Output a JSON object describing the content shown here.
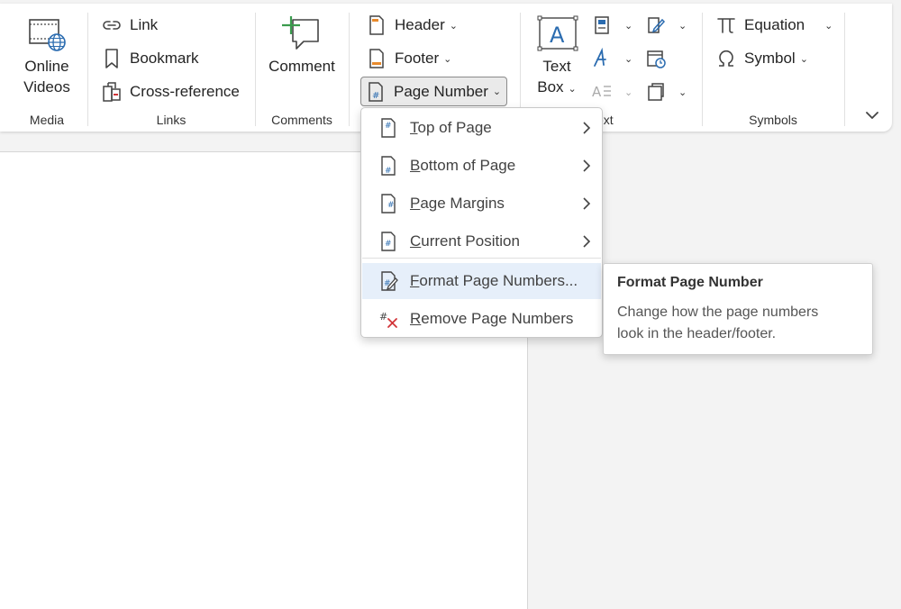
{
  "ribbon": {
    "media": {
      "label": "Media",
      "online_videos_line1": "Online",
      "online_videos_line2": "Videos"
    },
    "links": {
      "label": "Links",
      "link": "Link",
      "bookmark": "Bookmark",
      "cross_reference": "Cross-reference"
    },
    "comments": {
      "label": "Comments",
      "comment": "Comment"
    },
    "header_footer": {
      "header": "Header",
      "footer": "Footer",
      "page_number": "Page Number"
    },
    "text": {
      "label_visible": "ext",
      "text_box_line1": "Text",
      "text_box_line2": "Box"
    },
    "symbols": {
      "label": "Symbols",
      "equation": "Equation",
      "symbol": "Symbol"
    },
    "chevron": "⌄"
  },
  "page_number_menu": {
    "items": [
      {
        "label": "Top of Page",
        "accel": "T",
        "rest": "op of Page",
        "submenu": true
      },
      {
        "label": "Bottom of Page",
        "accel": "B",
        "rest": "ottom of Page",
        "submenu": true
      },
      {
        "label": "Page Margins",
        "accel": "P",
        "rest": "age Margins",
        "submenu": true
      },
      {
        "label": "Current Position",
        "accel": "C",
        "rest": "urrent Position",
        "submenu": true
      },
      {
        "label": "Format Page Numbers...",
        "accel": "F",
        "rest": "ormat Page Numbers...",
        "submenu": false,
        "highlighted": true
      },
      {
        "label": "Remove Page Numbers",
        "accel": "R",
        "rest": "emove Page Numbers",
        "submenu": false
      }
    ]
  },
  "tooltip": {
    "title": "Format Page Number",
    "body_line1": "Change how the page numbers",
    "body_line2": "look in the header/footer."
  },
  "colors": {
    "accent_blue": "#2b6cb0",
    "comment_green": "#3a9b4d",
    "remove_red": "#d13438",
    "highlight": "#e6effa"
  }
}
